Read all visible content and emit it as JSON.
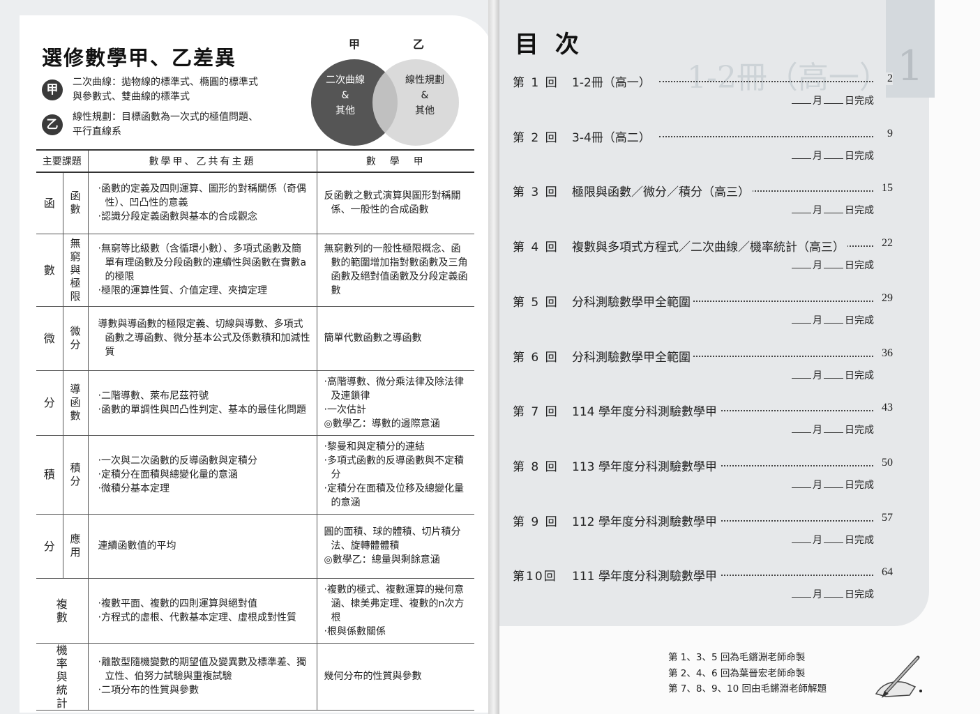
{
  "left": {
    "title": "選修數學甲、乙差異",
    "badges": [
      {
        "mark": "甲",
        "line1": "二次曲線：拋物線的標準式、橢圓的標準式",
        "line2": "與參數式、雙曲線的標準式"
      },
      {
        "mark": "乙",
        "line1": "線性規劃：目標函數為一次式的極值問題、",
        "line2": "平行直線系"
      }
    ],
    "venn": {
      "label_a": "甲",
      "label_b": "乙",
      "left_lines": [
        "二次曲線",
        "&",
        "其他"
      ],
      "right_lines": [
        "線性規劃",
        "&",
        "其他"
      ]
    },
    "table": {
      "headers": [
        "主要課題",
        "數學甲、乙共有主題",
        "數　學　甲"
      ],
      "rows": [
        {
          "main": "函",
          "sub": "函數",
          "common": [
            "‧函數的定義及四則運算、圖形的對稱關係（奇偶性）、凹凸性的意義",
            "‧認識分段定義函數與基本的合成觀念"
          ],
          "jia": [
            "反函數之數式演算與圖形對稱關係、一般性的合成函數"
          ]
        },
        {
          "main": "數",
          "sub": "無窮與極限",
          "common": [
            "‧無窮等比級數（含循環小數）、多項式函數及簡單有理函數及分段函數的連續性與函數在實數a的極限",
            "‧極限的運算性質、介值定理、夾擠定理"
          ],
          "jia": [
            "無窮數列的一般性極限概念、函數的範圍增加指對數函數及三角函數及絕對值函數及分段定義函數"
          ]
        },
        {
          "main": "微",
          "sub": "微分",
          "common": [
            "導數與導函數的極限定義、切線與導數、多項式函數之導函數、微分基本公式及係數積和加減性質"
          ],
          "jia": [
            "簡單代數函數之導函數"
          ]
        },
        {
          "main": "分",
          "sub": "導函數",
          "common": [
            "‧二階導數、萊布尼茲符號",
            "‧函數的單調性與凹凸性判定、基本的最佳化問題"
          ],
          "jia": [
            "‧高階導數、微分乘法律及除法律及連鎖律",
            "‧一次估計",
            "◎數學乙：導數的邊際意涵"
          ]
        },
        {
          "main": "積",
          "sub": "積分",
          "common": [
            "‧一次與二次函數的反導函數與定積分",
            "‧定積分在面積與總變化量的意涵",
            "‧微積分基本定理"
          ],
          "jia": [
            "‧黎曼和與定積分的連結",
            "‧多項式函數的反導函數與不定積分",
            "‧定積分在面積及位移及總變化量的意涵"
          ]
        },
        {
          "main": "分",
          "sub": "應用",
          "common": [
            "連續函數值的平均"
          ],
          "jia": [
            "圓的面積、球的體積、切片積分法、旋轉體體積",
            "◎數學乙：總量與剩餘意涵"
          ]
        },
        {
          "main": "複數",
          "sub": "",
          "common": [
            "‧複數平面、複數的四則運算與絕對值",
            "‧方程式的虛根、代數基本定理、虛根成對性質"
          ],
          "jia": [
            "‧複數的極式、複數運算的幾何意涵、棣美弗定理、複數的n次方根",
            "‧根與係數關係"
          ]
        },
        {
          "main": "機率與統計",
          "sub": "",
          "common": [
            "‧離散型隨機變數的期望值及變異數及標準差、獨立性、伯努力試驗與重複試驗",
            "‧二項分布的性質與參數"
          ],
          "jia": [
            "幾何分布的性質與參數"
          ]
        }
      ]
    }
  },
  "right": {
    "title": "目 次",
    "tab_number": "1",
    "done_label": {
      "month": "月",
      "day_done": "日完成"
    },
    "toc": [
      {
        "no": "第 1 回",
        "title": "1-2冊（高一）",
        "page": "2"
      },
      {
        "no": "第 2 回",
        "title": "3-4冊（高二）",
        "page": "9"
      },
      {
        "no": "第 3 回",
        "title": "極限與函數／微分／積分（高三）",
        "page": "15"
      },
      {
        "no": "第 4 回",
        "title": "複數與多項式方程式／二次曲線／機率統計（高三）",
        "page": "22"
      },
      {
        "no": "第 5 回",
        "title": "分科測驗數學甲全範圍",
        "page": "29"
      },
      {
        "no": "第 6 回",
        "title": "分科測驗數學甲全範圍",
        "page": "36"
      },
      {
        "no": "第 7 回",
        "title": "114 學年度分科測驗數學甲",
        "page": "43"
      },
      {
        "no": "第 8 回",
        "title": "113 學年度分科測驗數學甲",
        "page": "50"
      },
      {
        "no": "第 9 回",
        "title": "112 學年度分科測驗數學甲",
        "page": "57"
      },
      {
        "no": "第10回",
        "title": "111 學年度分科測驗數學甲",
        "page": "64"
      }
    ],
    "credits": [
      "第 1、3、5 回為毛鏘淵老師命製",
      "第 2、4、6 回為葉晉宏老師命製",
      "第 7、8、9、10 回由毛鏘淵老師解題"
    ]
  }
}
